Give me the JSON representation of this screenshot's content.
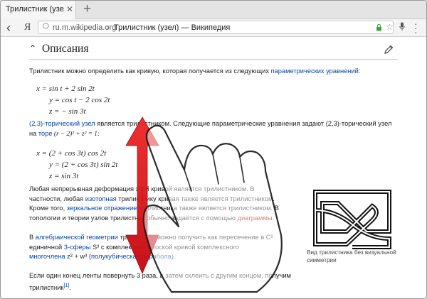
{
  "browser": {
    "tab_title": "Трилистник (узел) — ",
    "tab_close": "✕",
    "new_tab": "+",
    "back": "‹",
    "yandex_logo": "Я",
    "url_domain": "ru.m.wikipedia.org",
    "url_separator": "›",
    "url_title": "Трилистник (узел) — Википедия",
    "star": "☆"
  },
  "section": {
    "chevron": "⌃",
    "title": "Описания"
  },
  "content": {
    "intro_text": "Трилистник можно определить как кривую, которая получается из следующих ",
    "intro_link": "параметрических уравнений",
    "intro_end": ":",
    "eq1": [
      "x = sin t + 2 sin 2t",
      "y = cos t − 2 cos 2t",
      "z = − sin 3t"
    ],
    "torus_p1_link": "(2,3)-торический узел",
    "torus_p1_text": " является трилистником. Следующие параметрические уравнения задают (2,3)-торический узел",
    "torus_p2_text": "на ",
    "torus_p2_link": "торе",
    "torus_p2_formula": " (r − 2)² + z² = 1:",
    "eq2": [
      "x = (2 + cos 3t) cos 2t",
      "y = (2 + cos 3t) sin 2t",
      "z = sin 3t"
    ],
    "para3_l1": "Любая непрерывная деформация этой кривой является трилистником. В",
    "para3_l2a": "частности, любая ",
    "para3_l2link": "изотопная",
    "para3_l2b": " трилистнику кривая также является трилистником.",
    "para3_l3a": "Кроме того, ",
    "para3_l3link": "зеркальное отражение",
    "para3_l3b": " трилистника также является трилистником. В",
    "para3_l4a": "топологии и теории узлов трилистник обычно задаётся с помощью ",
    "para3_l4link": "диаграммы",
    "para3_l4b": ".",
    "para4_l1a": "В ",
    "para4_l1link": "алгебраической геометрии",
    "para4_l1b": " трилистник можно получить как пересечение в C²",
    "para4_l2a": "единичной ",
    "para4_l2link": "3-сферы",
    "para4_l2b": " S³ с комплексной плоской кривой комплексного",
    "para4_l3link": "многочлена",
    "para4_l3b": " z² + w³ ",
    "para4_l3link2": "(полукубическая парабола)",
    "para4_l3c": ".",
    "para5_l1": "Если один конец ленты повернуть 3 раза, а затем склеить с другим концом, получим",
    "para5_l2": "трилистник",
    "para5_ref": "[1]",
    "para5_end": "."
  },
  "figure": {
    "caption": "Вид трилистника без визуальной симметрии"
  },
  "colors": {
    "link": "#0645ad",
    "red_link": "#ba0000",
    "arrow_red": "#e0141c",
    "url_lock_green": "#3aa540"
  },
  "gesture": {
    "description": "swipe-up-down-hint"
  }
}
